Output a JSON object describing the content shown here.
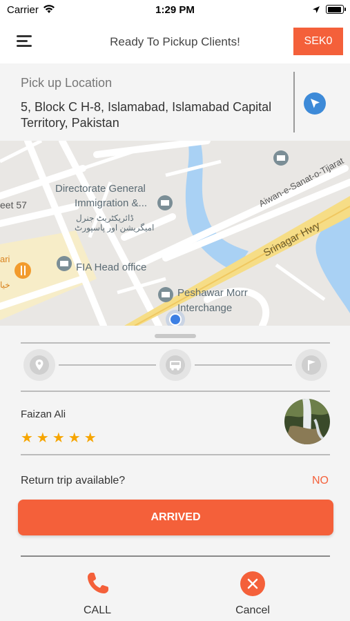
{
  "status_bar": {
    "carrier": "Carrier",
    "time": "1:29 PM"
  },
  "header": {
    "title": "Ready To Pickup Clients!",
    "sek_label": "SEK0"
  },
  "pickup": {
    "label": "Pick up Location",
    "address": "5, Block C H-8, Islamabad, Islamabad Capital Territory, Pakistan"
  },
  "map": {
    "labels": {
      "directorate_line1": "Directorate General",
      "directorate_line2": "Immigration &...",
      "directorate_urdu_line1": "ڈائریکٹریٹ جنرل",
      "directorate_urdu_line2": "امیگریشن اور پاسپورٹ",
      "street57": "eet 57",
      "fia": "FIA Head office",
      "peshawar_line1": "Peshawar Morr",
      "peshawar_line2": "Interchange",
      "srinagar": "Srinagar Hwy",
      "aiwan": "Aiwan-e-Sanat-o-Tijarat",
      "ari": "ari",
      "urdu_left": "خیا"
    }
  },
  "driver": {
    "name": "Faizan Ali",
    "rating": 5,
    "stars": "★★★★★"
  },
  "return_trip": {
    "label": "Return trip available?",
    "value": "NO"
  },
  "arrived_label": "ARRIVED",
  "actions": {
    "call_label": "CALL",
    "cancel_label": "Cancel"
  },
  "colors": {
    "accent": "#f4603a",
    "star": "#f6a500",
    "nav": "#3d8ad8"
  }
}
